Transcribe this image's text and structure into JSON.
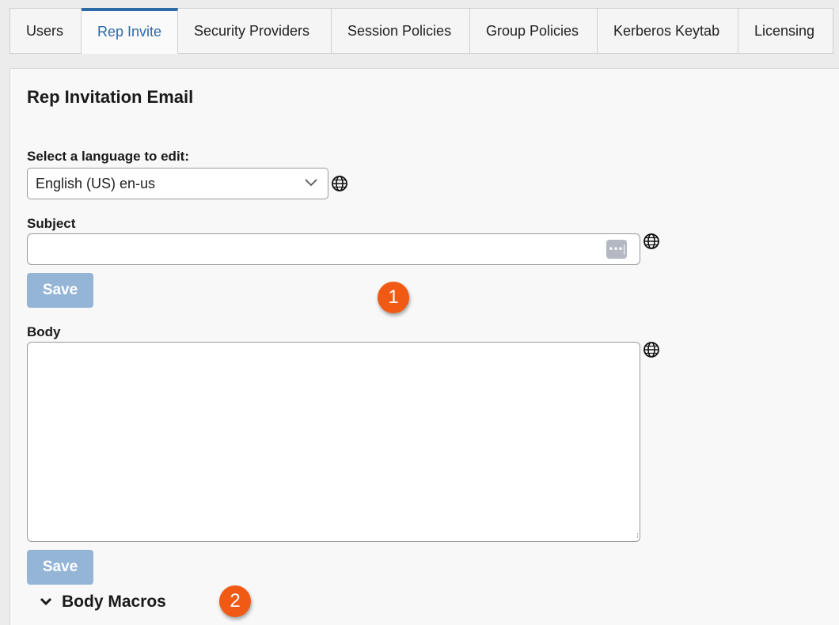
{
  "tabs": [
    {
      "label": "Users"
    },
    {
      "label": "Rep Invite"
    },
    {
      "label": "Security Providers"
    },
    {
      "label": "Session Policies"
    },
    {
      "label": "Group Policies"
    },
    {
      "label": "Kerberos Keytab"
    },
    {
      "label": "Licensing"
    }
  ],
  "active_tab": "Rep Invite",
  "page": {
    "title": "Rep Invitation Email"
  },
  "language": {
    "label": "Select a language to edit:",
    "selected": "English (US) en-us"
  },
  "subject": {
    "label": "Subject",
    "value": "",
    "save_label": "Save"
  },
  "body": {
    "label": "Body",
    "value": "",
    "save_label": "Save"
  },
  "macros": {
    "label": "Body Macros"
  },
  "markers": [
    "1",
    "2"
  ],
  "colors": {
    "accent": "#2e6aa8",
    "button_disabled": "#95b5d6",
    "marker": "#f05a14"
  }
}
